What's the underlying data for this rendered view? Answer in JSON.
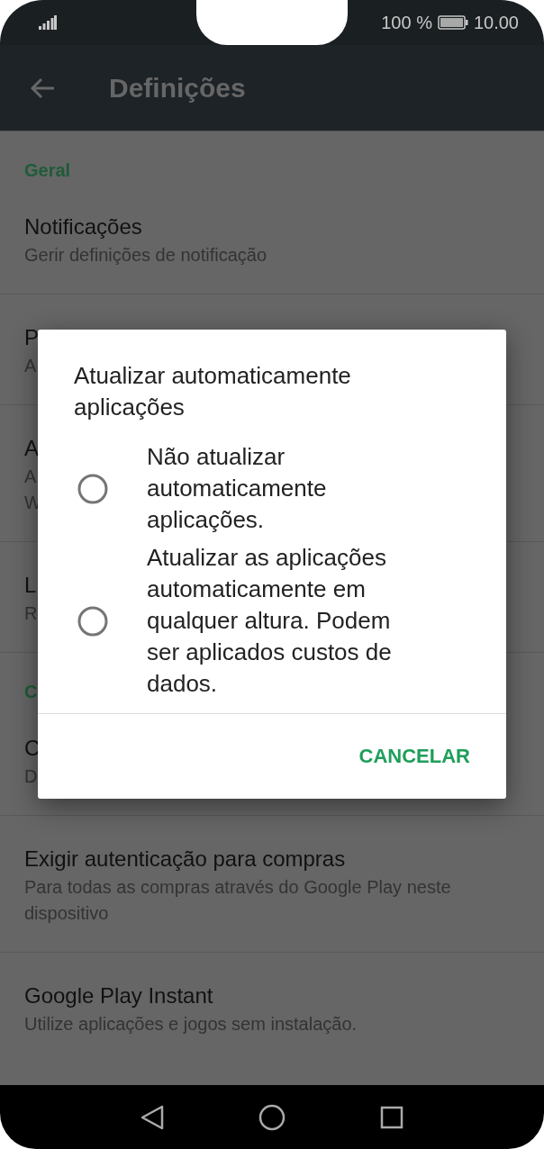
{
  "status_bar": {
    "battery": "100 %",
    "time": "10.00"
  },
  "app_bar": {
    "title": "Definições"
  },
  "settings": [
    {
      "kind": "header",
      "label": "Geral"
    },
    {
      "kind": "item",
      "title": "Notificações",
      "subtitle_lines": [
        "Gerir definições de notificação"
      ]
    },
    {
      "kind": "item",
      "title": "P",
      "subtitle_lines": [
        "A"
      ]
    },
    {
      "kind": "item",
      "title": "A",
      "subtitle_lines": [
        "A",
        "W"
      ]
    },
    {
      "kind": "item",
      "title": "L",
      "subtitle_lines": [
        "R"
      ]
    },
    {
      "kind": "header",
      "label": "C"
    },
    {
      "kind": "item",
      "title": "C",
      "subtitle_lines": [
        "D"
      ]
    },
    {
      "kind": "item",
      "title": "Exigir autenticação para compras",
      "subtitle_lines": [
        "Para todas as compras através do Google Play neste",
        "dispositivo"
      ]
    },
    {
      "kind": "item",
      "title": "Google Play Instant",
      "subtitle_lines": [
        "Utilize aplicações e jogos sem instalação."
      ]
    }
  ],
  "dialog": {
    "title": "Atualizar automaticamente aplicações",
    "options": [
      {
        "label": "Não atualizar automaticamente aplicações.",
        "selected": false
      },
      {
        "label": "Atualizar as aplicações automaticamente em qualquer altura. Podem ser aplicados custos de dados.",
        "selected": false
      }
    ],
    "button": "CANCELAR"
  }
}
